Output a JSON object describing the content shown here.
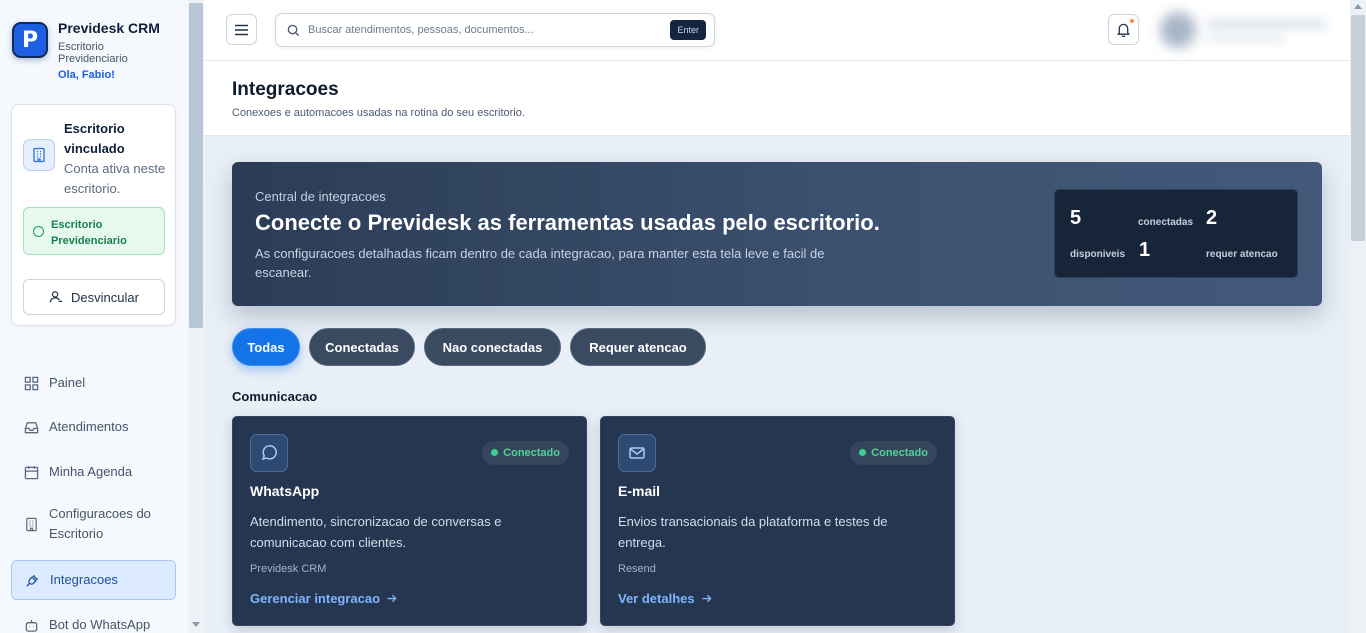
{
  "brand": {
    "logo_letter": "P",
    "title": "Previdesk CRM",
    "subtitle": "Escritorio Previdenciario",
    "greeting": "Ola, Fabio!"
  },
  "office_card": {
    "title": "Escritorio vinculado",
    "description": "Conta ativa neste escritorio.",
    "chip_label": "Escritorio Previdenciario",
    "unlink_label": "Desvincular"
  },
  "nav": {
    "items": [
      {
        "label": "Painel",
        "icon": "grid-icon"
      },
      {
        "label": "Atendimentos",
        "icon": "inbox-icon"
      },
      {
        "label": "Minha Agenda",
        "icon": "calendar-icon"
      },
      {
        "label": "Configuracoes do Escritorio",
        "icon": "building-icon"
      },
      {
        "label": "Integracoes",
        "icon": "plug-icon",
        "active": true
      },
      {
        "label": "Bot do WhatsApp",
        "icon": "bot-icon"
      }
    ]
  },
  "topbar": {
    "search_placeholder": "Buscar atendimentos, pessoas, documentos...",
    "search_hint": "Enter"
  },
  "page": {
    "title": "Integracoes",
    "subtitle": "Conexoes e automacoes usadas na rotina do seu escritorio."
  },
  "hero": {
    "eyebrow": "Central de integracoes",
    "title": "Conecte o Previdesk as ferramentas usadas pelo escritorio.",
    "description": "As configuracoes detalhadas ficam dentro de cada integracao, para manter esta tela leve e facil de escanear.",
    "stats": {
      "available_count": "5",
      "available_label": "disponiveis",
      "connected_count": "2",
      "connected_label": "conectadas",
      "attention_count": "1",
      "attention_label": "requer atencao"
    }
  },
  "filters": [
    {
      "label": "Todas",
      "active": true
    },
    {
      "label": "Conectadas"
    },
    {
      "label": "Nao conectadas"
    },
    {
      "label": "Requer atencao"
    }
  ],
  "section": {
    "label": "Comunicacao"
  },
  "cards": [
    {
      "icon": "chat-bubble-icon",
      "status": "Conectado",
      "title": "WhatsApp",
      "description": "Atendimento, sincronizacao de conversas e comunicacao com clientes.",
      "provider": "Previdesk CRM",
      "link": "Gerenciar integracao"
    },
    {
      "icon": "mail-icon",
      "status": "Conectado",
      "title": "E-mail",
      "description": "Envios transacionais da plataforma e testes de entrega.",
      "provider": "Resend",
      "link": "Ver detalhes"
    }
  ],
  "colors": {
    "accent": "#1573e8",
    "hero_bg": "#2b3c56",
    "card_bg": "#253650",
    "status_green": "#3ccf8e",
    "link_blue": "#7fb4ff"
  }
}
